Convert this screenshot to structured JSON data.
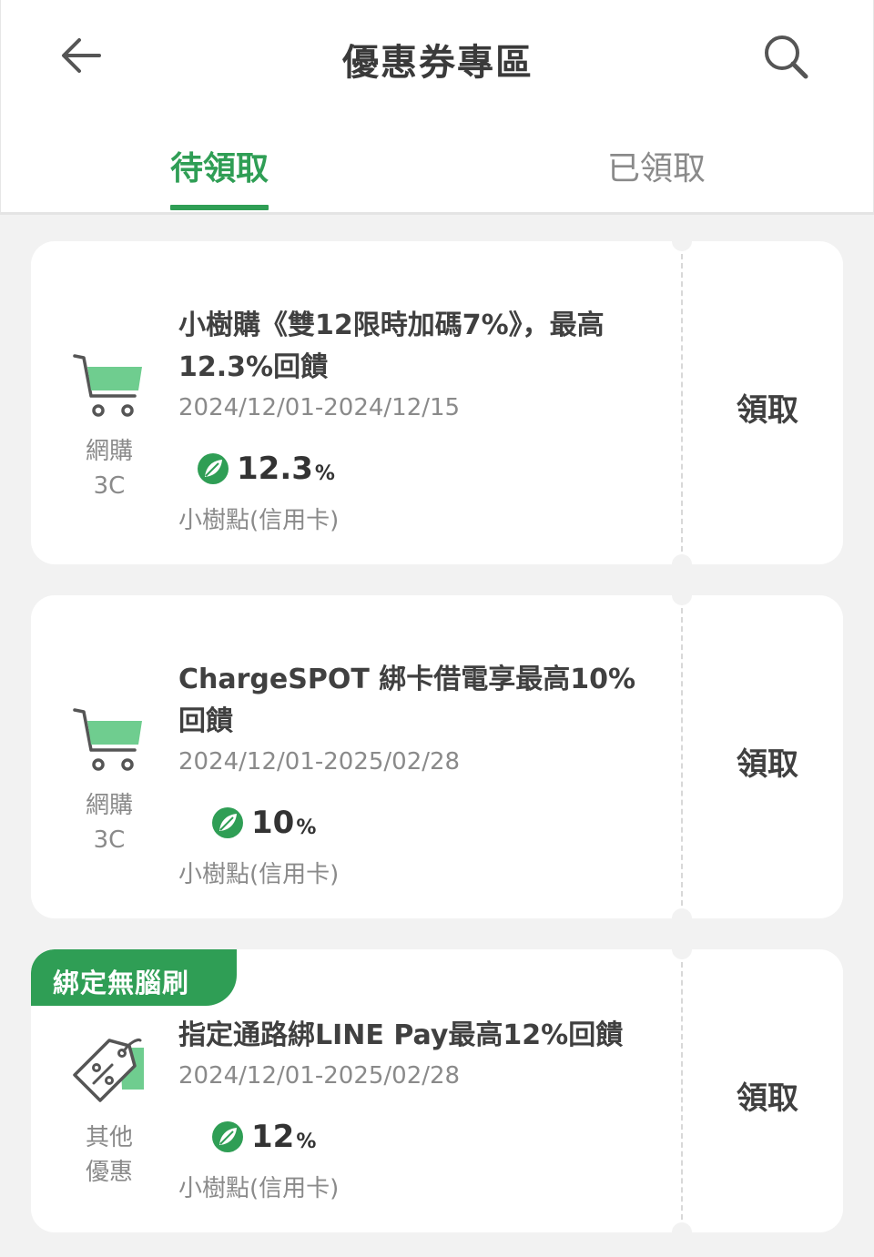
{
  "header": {
    "title": "優惠券專區",
    "back_icon": "arrow-left-icon",
    "search_icon": "search-icon"
  },
  "tabs": [
    {
      "label": "待領取",
      "active": true
    },
    {
      "label": "已領取",
      "active": false
    }
  ],
  "colors": {
    "accent": "#2f9e55",
    "icon_green": "#6fcd8f",
    "background": "#f2f2f2"
  },
  "coupons": [
    {
      "category_icon": "shopping-cart-icon",
      "category_line1": "網購",
      "category_line2": "3C",
      "title": "小樹購《雙12限時加碼7%》，最高12.3%回饋",
      "date": "2024/12/01-2024/12/15",
      "reward_value": "12.3",
      "reward_unit": "%",
      "reward_type": "小樹點(信用卡)",
      "action": "領取"
    },
    {
      "category_icon": "shopping-cart-icon",
      "category_line1": "網購",
      "category_line2": "3C",
      "title": "ChargeSPOT 綁卡借電享最高10% 回饋",
      "date": "2024/12/01-2025/02/28",
      "reward_value": "10",
      "reward_unit": "%",
      "reward_type": "小樹點(信用卡)",
      "action": "領取"
    },
    {
      "badge": "綁定無腦刷",
      "category_icon": "discount-tag-icon",
      "category_line1": "其他",
      "category_line2": "優惠",
      "title": "指定通路綁LINE Pay最高12%回饋",
      "date": "2024/12/01-2025/02/28",
      "reward_value": "12",
      "reward_unit": "%",
      "reward_type": "小樹點(信用卡)",
      "action": "領取"
    }
  ]
}
